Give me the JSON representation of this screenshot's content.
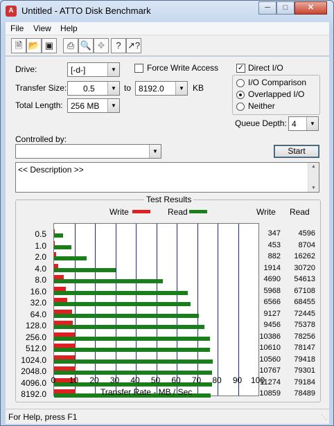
{
  "window": {
    "title": "Untitled - ATTO Disk Benchmark",
    "app_icon_text": "A",
    "status": "For Help, press F1"
  },
  "menu": [
    "File",
    "View",
    "Help"
  ],
  "toolbar": [
    "new-icon",
    "open-icon",
    "save-icon",
    "print-icon",
    "print-preview-icon",
    "move-icon",
    "help-icon",
    "context-help-icon"
  ],
  "form": {
    "drive_label": "Drive:",
    "drive_value": "[-d-]",
    "force_write_label": "Force Write Access",
    "force_write_checked": false,
    "direct_io_label": "Direct I/O",
    "direct_io_checked": true,
    "transfer_size_label": "Transfer Size:",
    "transfer_from": "0.5",
    "to_label": "to",
    "transfer_to": "8192.0",
    "kb_label": "KB",
    "total_length_label": "Total Length:",
    "total_length_value": "256 MB",
    "io_options": [
      "I/O Comparison",
      "Overlapped I/O",
      "Neither"
    ],
    "io_selected": 1,
    "queue_depth_label": "Queue Depth:",
    "queue_depth_value": "4",
    "controlled_by_label": "Controlled by:",
    "controlled_by_value": "",
    "start_label": "Start",
    "description": "<< Description >>"
  },
  "results": {
    "title": "Test Results",
    "legend_write": "Write",
    "legend_read": "Read",
    "col_write": "Write",
    "col_read": "Read",
    "xlabel": "Transfer Rate - MB / Sec"
  },
  "chart_data": {
    "type": "bar",
    "orientation": "horizontal",
    "title": "Test Results",
    "xlabel": "Transfer Rate - MB / Sec",
    "xlim": [
      0,
      100
    ],
    "xticks": [
      "0",
      "10",
      "20",
      "30",
      "40",
      "50",
      "60",
      "70",
      "80",
      "90",
      "100"
    ],
    "categories": [
      "0.5",
      "1.0",
      "2.0",
      "4.0",
      "8.0",
      "16.0",
      "32.0",
      "64.0",
      "128.0",
      "256.0",
      "512.0",
      "1024.0",
      "2048.0",
      "4096.0",
      "8192.0"
    ],
    "series": [
      {
        "name": "Write",
        "color": "#e02020",
        "values": [
          0.3,
          0.4,
          0.9,
          1.9,
          4.6,
          5.8,
          6.4,
          8.9,
          9.2,
          10.1,
          10.4,
          10.3,
          10.5,
          11.0,
          10.6
        ],
        "labels": [
          "347",
          "453",
          "882",
          "1914",
          "4690",
          "5968",
          "6566",
          "9127",
          "9456",
          "10386",
          "10610",
          "10560",
          "10767",
          "11274",
          "10859"
        ]
      },
      {
        "name": "Read",
        "color": "#1a7f1a",
        "values": [
          4.5,
          8.5,
          15.9,
          30.0,
          53.3,
          65.5,
          66.8,
          70.7,
          73.6,
          76.4,
          76.3,
          77.6,
          77.4,
          77.3,
          76.6
        ],
        "labels": [
          "4596",
          "8704",
          "16262",
          "30720",
          "54613",
          "67108",
          "68455",
          "72445",
          "75378",
          "78256",
          "78147",
          "79418",
          "79301",
          "79184",
          "78489"
        ]
      }
    ],
    "grid": true,
    "legend": "top"
  }
}
